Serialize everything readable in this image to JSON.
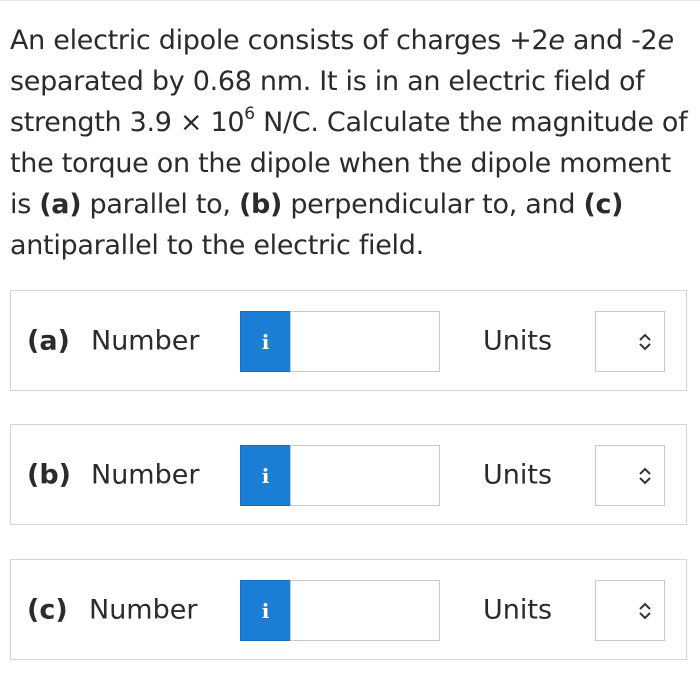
{
  "question": {
    "line1_pre": "An electric dipole consists of charges +2",
    "line1_e1": "e",
    "line1_mid": " and -2",
    "line1_e2": "e",
    "line2": "separated by 0.68 nm. It is in an electric field of",
    "line3_pre": "strength 3.9 × 10",
    "line3_exp": "6",
    "line3_post": " N/C. Calculate the magnitude of",
    "line4": "the torque on the dipole when the dipole moment",
    "line5_pre": "is ",
    "part_a": "(a)",
    "line5_mid1": " parallel to, ",
    "part_b": "(b)",
    "line5_mid2": " perpendicular to, and ",
    "part_c": "(c)",
    "line6": "antiparallel to the electric field."
  },
  "rows": [
    {
      "part": "(a)",
      "number_label": "Number",
      "info_glyph": "i",
      "value": "",
      "units_label": "Units",
      "units_selected": ""
    },
    {
      "part": "(b)",
      "number_label": "Number",
      "info_glyph": "i",
      "value": "",
      "units_label": "Units",
      "units_selected": ""
    },
    {
      "part": "(c)",
      "number_label": "Number",
      "info_glyph": "i",
      "value": "",
      "units_label": "Units",
      "units_selected": ""
    }
  ],
  "colors": {
    "info_button": "#1a7fd4",
    "border": "#d4d4d4",
    "text": "#2b2b2b"
  },
  "icons": {
    "info": "info-icon",
    "select": "up-down-chevron-icon"
  }
}
